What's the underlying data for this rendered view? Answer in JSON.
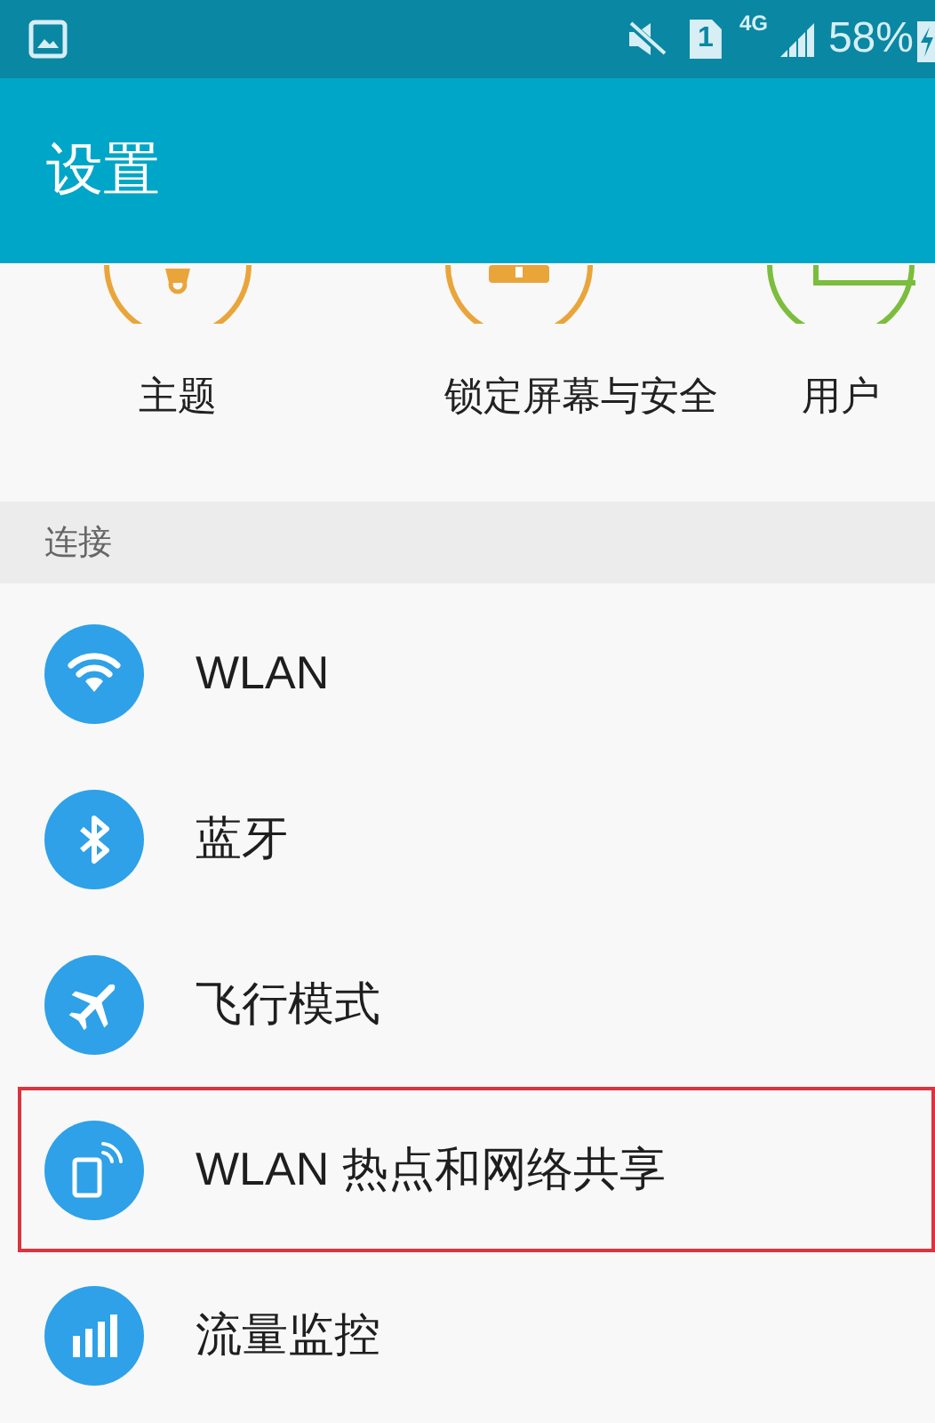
{
  "status_bar": {
    "sim_slot": "1",
    "network": "4G",
    "battery": "58%"
  },
  "app_bar": {
    "title": "设置"
  },
  "quick_settings": [
    {
      "label": "主题"
    },
    {
      "label": "锁定屏幕与安全"
    },
    {
      "label": "用户"
    }
  ],
  "section": {
    "title": "连接"
  },
  "items": [
    {
      "label": "WLAN",
      "highlighted": false
    },
    {
      "label": "蓝牙",
      "highlighted": false
    },
    {
      "label": "飞行模式",
      "highlighted": false
    },
    {
      "label": "WLAN 热点和网络共享",
      "highlighted": true
    },
    {
      "label": "流量监控",
      "highlighted": false
    }
  ]
}
